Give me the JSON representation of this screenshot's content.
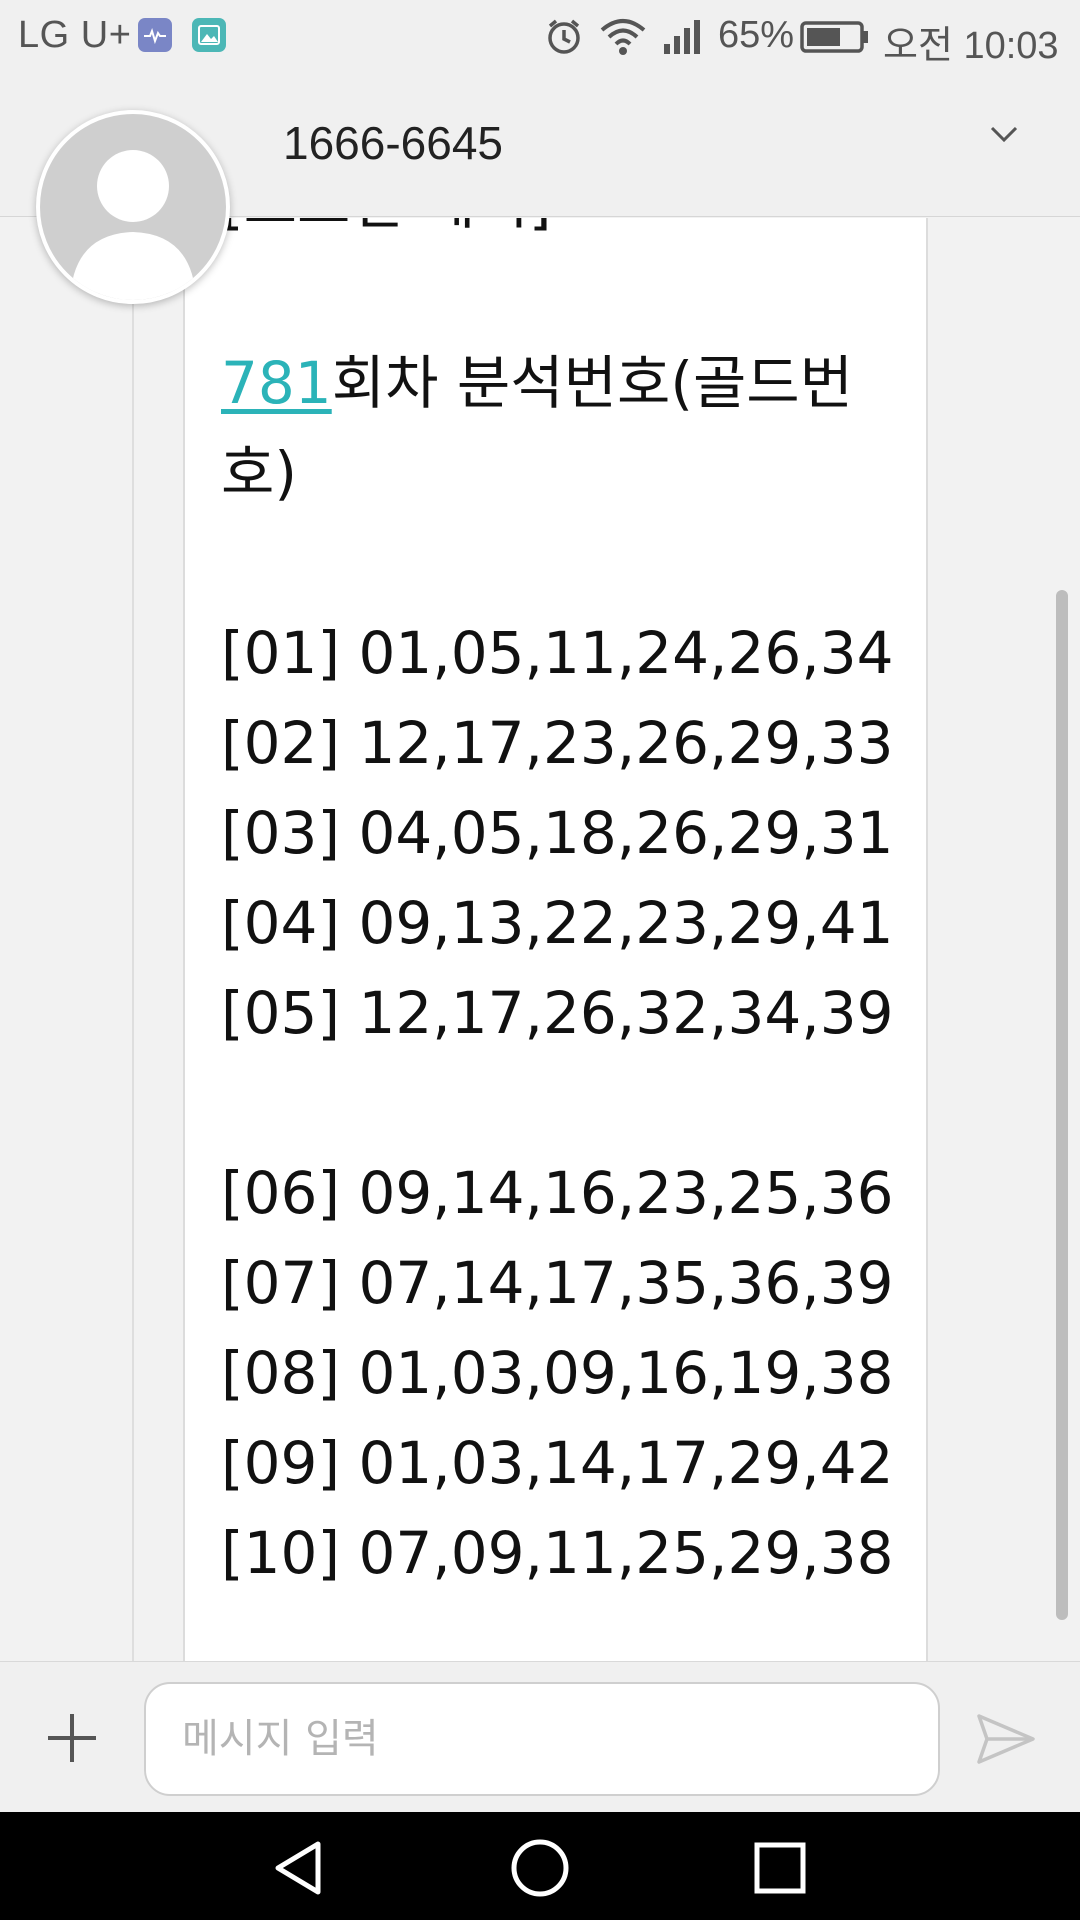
{
  "status_bar": {
    "carrier": "LG U+",
    "battery_percent": "65%",
    "battery_level": 0.65,
    "time": "오전 10:03",
    "icons": [
      "health-app-icon",
      "gallery-app-icon",
      "alarm-icon",
      "wifi-icon",
      "signal-icon",
      "battery-icon"
    ]
  },
  "header": {
    "contact_name": "1666-6645",
    "expand_icon": "chevron-down-icon"
  },
  "message": {
    "clipped_line": "[로또번 제시]",
    "round_number": "781",
    "round_title_rest": "회차 분석번호(골드번",
    "round_title_cont": "호)",
    "group_one": [
      "[01] 01,05,11,24,26,34",
      "[02] 12,17,23,26,29,33",
      "[03] 04,05,18,26,29,31",
      "[04] 09,13,22,23,29,41",
      "[05] 12,17,26,32,34,39"
    ],
    "group_two": [
      "[06] 09,14,16,23,25,36",
      "[07] 07,14,17,35,36,39",
      "[08] 01,03,09,16,19,38",
      "[09] 01,03,14,17,29,42",
      "[10] 07,09,11,25,29,38"
    ]
  },
  "composer": {
    "placeholder": "메시지 입력",
    "add_icon": "plus-icon",
    "send_icon": "send-icon"
  },
  "colors": {
    "link": "#2bb3b8",
    "background": "#f2f2f2",
    "bubble": "#ffffff"
  }
}
